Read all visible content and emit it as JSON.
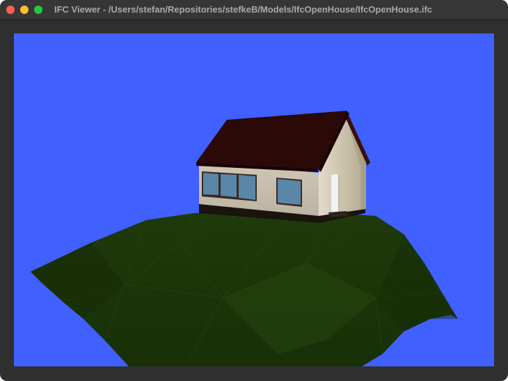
{
  "window": {
    "title": "IFC Viewer - /Users/stefan/Repositories/stefkeB/Models/IfcOpenHouse/IfcOpenHouse.ifc",
    "controls": [
      "close",
      "minimize",
      "zoom"
    ]
  },
  "viewport": {
    "background_color": "#4060ff",
    "model": {
      "terrain_color": "#1e3a0c",
      "roof_color": "#2a0906",
      "wall_color": "#c9c1b0",
      "window_glass_color": "#5a86a8",
      "door_color": "#f2f2f2",
      "foundation_color": "#1a130e"
    }
  }
}
